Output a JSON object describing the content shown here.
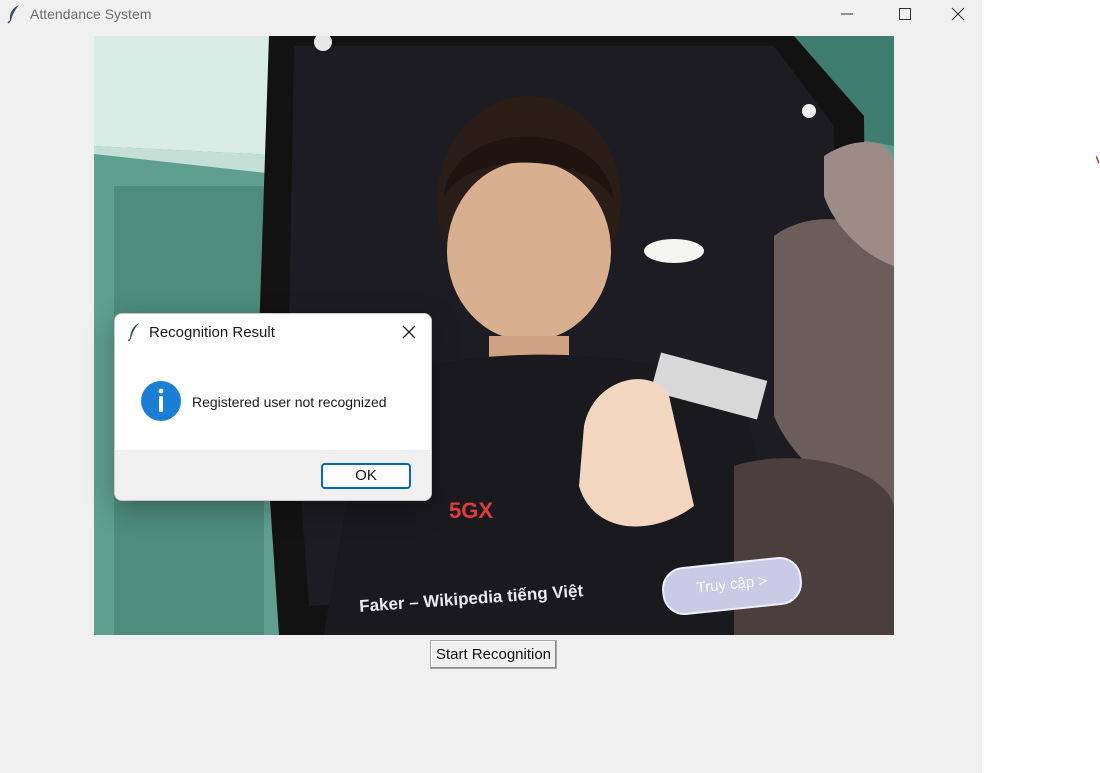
{
  "window": {
    "title": "Attendance System",
    "title_icon": "feather-icon",
    "controls": [
      "minimize-icon",
      "maximize-icon",
      "close-icon"
    ]
  },
  "camera_feed": {
    "caption": "Faker – Wikipedia tiếng Việt",
    "pill_label": "Truy cập >"
  },
  "start_button": {
    "label": "Start Recognition"
  },
  "dialog": {
    "title": "Recognition Result",
    "title_icon": "feather-icon",
    "icon": "info-icon",
    "message": "Registered user not recognized",
    "ok_label": "OK",
    "ok_border_color": "#0067c0",
    "info_color": "#1a7fd4"
  }
}
